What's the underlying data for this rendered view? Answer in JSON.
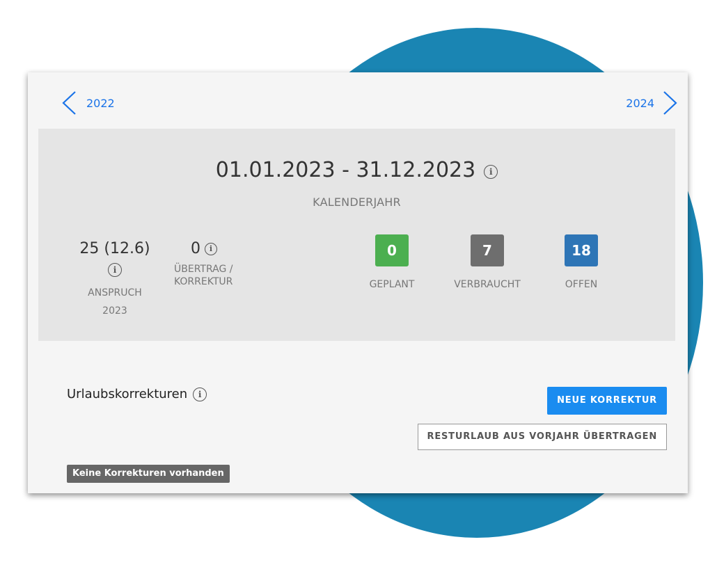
{
  "nav": {
    "prev_year": "2022",
    "next_year": "2024"
  },
  "period": {
    "range": "01.01.2023 - 31.12.2023",
    "type": "KALENDERJAHR",
    "info_icon": "i"
  },
  "claim": {
    "value": "25 (12.6)",
    "label": "ANSPRUCH",
    "year": "2023",
    "info_icon": "i"
  },
  "carryover": {
    "value": "0",
    "label_line1": "ÜBERTRAG /",
    "label_line2": "KORREKTUR",
    "info_icon": "i"
  },
  "status": [
    {
      "value": "7",
      "label": "VERBRAUCHT",
      "color": "#6e6e6e"
    },
    {
      "value": "0",
      "label": "GEPLANT",
      "color": "#4caf50"
    },
    {
      "value": "18",
      "label": "OFFEN",
      "color": "#2e75b6"
    }
  ],
  "corrections": {
    "title": "Urlaubskorrekturen",
    "info_icon": "i",
    "new_button": "NEUE KORREKTUR",
    "transfer_button": "RESTURLAUB AUS VORJAHR ÜBERTRAGEN",
    "empty_text": "Keine Korrekturen vorhanden"
  },
  "colors": {
    "accent": "#1a73e8",
    "primary_button": "#1a8cf0",
    "background_circle": "#1a85b3"
  }
}
